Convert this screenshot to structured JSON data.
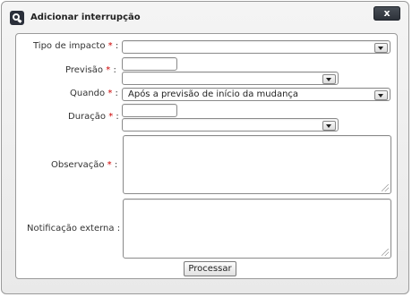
{
  "dialog": {
    "title": "Adicionar interrupção",
    "close_label": "x"
  },
  "form": {
    "required_mark": "*",
    "colon": ":",
    "fields": {
      "tipo_impacto": {
        "label": "Tipo de impacto",
        "value": ""
      },
      "previsao": {
        "label": "Previsão",
        "text_value": "",
        "select_value": ""
      },
      "quando": {
        "label": "Quando",
        "value": "Após a previsão de início da mudança"
      },
      "duracao": {
        "label": "Duração",
        "text_value": "",
        "select_value": ""
      },
      "observacao": {
        "label": "Observação",
        "value": ""
      },
      "notificacao_externa": {
        "label": "Notificação externa",
        "value": ""
      }
    },
    "submit_label": "Processar"
  }
}
